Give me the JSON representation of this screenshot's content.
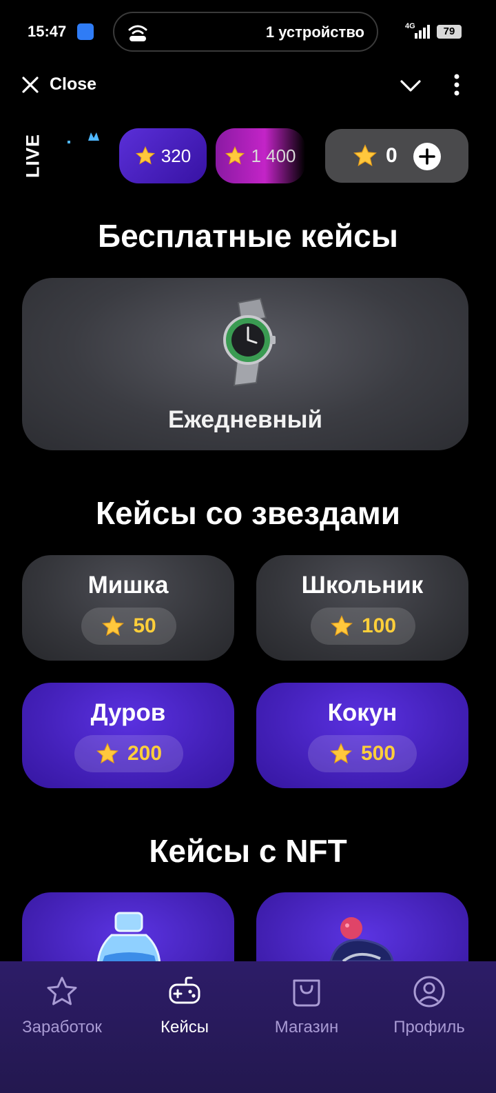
{
  "status_bar": {
    "time": "15:47",
    "island_text": "1 устройство",
    "network": "4G",
    "battery": "79"
  },
  "top_bar": {
    "close_label": "Close"
  },
  "live": {
    "label": "LIVE",
    "chips": [
      {
        "value": "320"
      },
      {
        "value": "1 400"
      }
    ],
    "balance": "0"
  },
  "free_cases": {
    "title": "Бесплатные кейсы",
    "daily_label": "Ежедневный"
  },
  "star_cases": {
    "title": "Кейсы со звездами",
    "items": [
      {
        "name": "Мишка",
        "price": "50"
      },
      {
        "name": "Школьник",
        "price": "100"
      },
      {
        "name": "Дуров",
        "price": "200"
      },
      {
        "name": "Кокун",
        "price": "500"
      }
    ]
  },
  "nft_cases": {
    "title": "Кейсы с NFT"
  },
  "tabs": [
    {
      "label": "Заработок",
      "icon": "star-outline-icon"
    },
    {
      "label": "Кейсы",
      "icon": "gamepad-icon",
      "active": true
    },
    {
      "label": "Магазин",
      "icon": "shopping-bag-icon"
    },
    {
      "label": "Профиль",
      "icon": "profile-icon"
    }
  ],
  "colors": {
    "accent_purple": "#4a25c8",
    "star_gold": "#ffcf3a",
    "card_gray": "#3a3b40"
  }
}
